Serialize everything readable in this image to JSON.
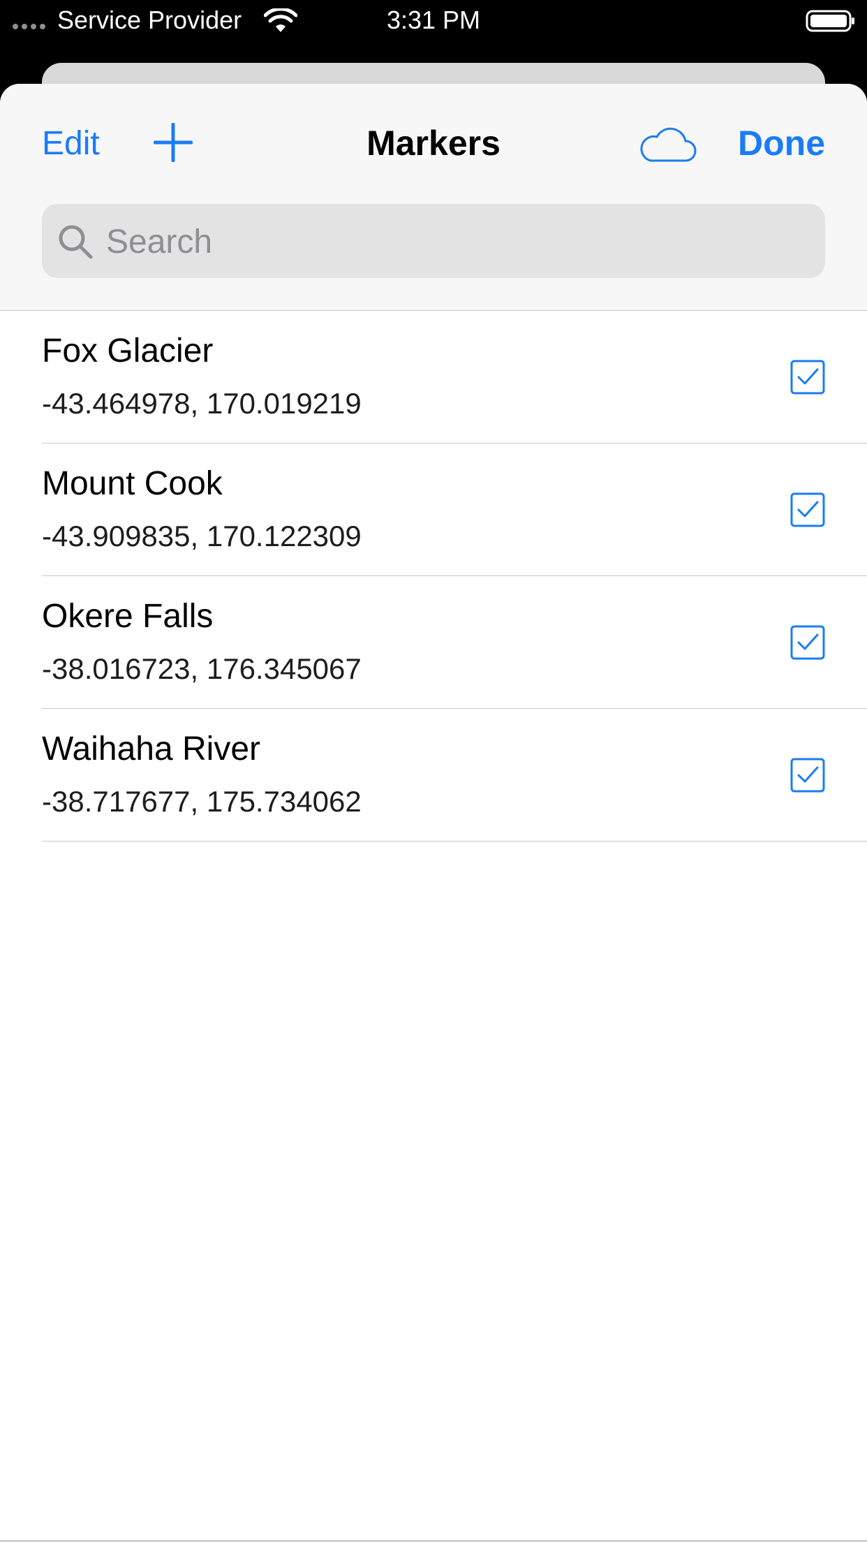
{
  "status_bar": {
    "carrier": "Service Provider",
    "time": "3:31 PM"
  },
  "nav": {
    "edit_label": "Edit",
    "title": "Markers",
    "done_label": "Done"
  },
  "search": {
    "placeholder": "Search",
    "value": ""
  },
  "markers": [
    {
      "name": "Fox Glacier",
      "coords": "-43.464978, 170.019219",
      "checked": true
    },
    {
      "name": "Mount Cook",
      "coords": "-43.909835, 170.122309",
      "checked": true
    },
    {
      "name": "Okere Falls",
      "coords": "-38.016723, 176.345067",
      "checked": true
    },
    {
      "name": "Waihaha River",
      "coords": "-38.717677, 175.734062",
      "checked": true
    }
  ],
  "colors": {
    "accent": "#1a7cf5"
  }
}
